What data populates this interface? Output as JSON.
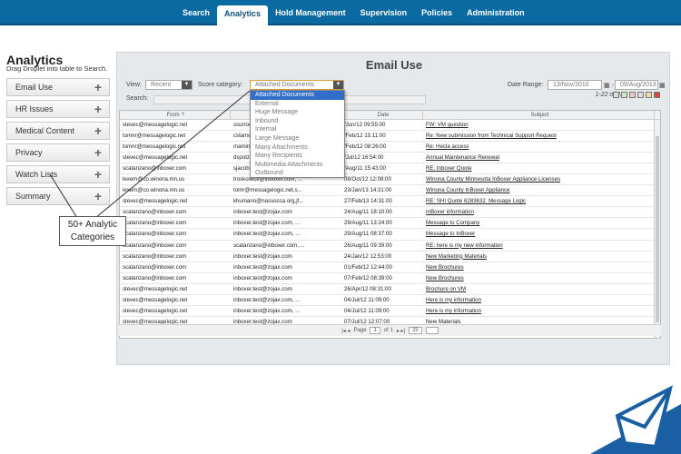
{
  "topnav": {
    "tabs": [
      {
        "label": "Search",
        "active": false
      },
      {
        "label": "Analytics",
        "active": true
      },
      {
        "label": "Hold Management",
        "active": false
      },
      {
        "label": "Supervision",
        "active": false
      },
      {
        "label": "Policies",
        "active": false
      },
      {
        "label": "Administration",
        "active": false
      }
    ]
  },
  "sidebar": {
    "title": "Analytics",
    "subtitle": "Drag Droplet into table to Search.",
    "items": [
      {
        "label": "Email Use"
      },
      {
        "label": "HR Issues"
      },
      {
        "label": "Medical Content"
      },
      {
        "label": "Privacy"
      },
      {
        "label": "Watch Lists"
      },
      {
        "label": "Summary"
      }
    ],
    "plus": "+"
  },
  "callout": {
    "line1": "50+ Analytic",
    "line2": "Categories"
  },
  "main": {
    "title": "Email Use",
    "view_label": "View:",
    "view_value": "Recent",
    "score_label": "Score category:",
    "score_value": "Attached Documents",
    "search_label": "Search:",
    "date_range_label": "Date Range:",
    "date_from": "13/Nov/2010",
    "date_to": "09/Aug/2013",
    "count": "1-22 of 22"
  },
  "dropdown": {
    "options": [
      "Attached Documents",
      "External",
      "Huge Message",
      "Inbound",
      "Internal",
      "Large Message",
      "Many Attachments",
      "Many Recipients",
      "Multimedia Attachments",
      "Outbound"
    ],
    "selected": "Attached Documents"
  },
  "table": {
    "headers": [
      "From ⇡",
      "",
      "Date",
      "Subject"
    ],
    "rows": [
      [
        "stevec@messagelogic.net",
        "ssurroc...",
        "/Jun/12 09:55:00",
        "FW: VM question"
      ],
      [
        "tomnr@messagelogic.net",
        "cstame...",
        "/Feb/12 15:11:00",
        "Re: New submission from Technical Support Request"
      ],
      [
        "tomnr@messagelogic.net",
        "mamin...",
        "/Feb/12 08:26:00",
        "Re: Hecla access"
      ],
      [
        "stevec@messagelogic.net",
        "dspotz...",
        "/Jul/12 16:54:00",
        "Annual Maintenance Renewal"
      ],
      [
        "scatanzano@inboxer.com",
        "sjacobz...",
        "/Aug/11 15:43:00",
        "RE: Inboxer Quote"
      ],
      [
        "lexem@co.winona.mn.us",
        "troskowick@inboxer.com, ...",
        "08/Oct/12 12:08:00",
        "Winona County Minnesota InBoxer Appliance Licenses"
      ],
      [
        "lexem@co.winona.mn.us",
        "tomr@messagelogic.net,s...",
        "23/Jan/13 14:31:00",
        "Winona County InBoxer Appliance"
      ],
      [
        "stevec@messagelogic.net",
        "khumann@nassocca.org,jf...",
        "27/Feb/13 14:31:00",
        "RE: SHI Quote 6283632. Message Logic"
      ],
      [
        "scatanzano@inboxer.com",
        "inboxer.test@zojax.com",
        "24/Aug/11 18:10:00",
        "InBoxer information"
      ],
      [
        "scatanzano@inboxer.com",
        "inboxer.test@zojax.com, ...",
        "29/Aug/11 13:24:00",
        "Message to Company"
      ],
      [
        "scatanzano@inboxer.com",
        "inboxer.test@zojax.com, ...",
        "29/Aug/11 08:37:00",
        "Message to InBoxer"
      ],
      [
        "scatanzano@inboxer.com",
        "scatanzano@inboxer.com, ...",
        "26/Aug/11 09:39:00",
        "RE: here is my new information"
      ],
      [
        "scatanzano@inboxer.com",
        "inboxer.test@zojax.com",
        "24/Jan/12 12:53:00",
        "New Marketing Materials"
      ],
      [
        "scatanzano@inboxer.com",
        "inboxer.test@zojax.com",
        "01/Feb/12 12:44:00",
        "New Brochures"
      ],
      [
        "scatanzano@inboxer.com",
        "inboxer.test@zojax.com",
        "07/Feb/12 08:39:00",
        "New Brochures"
      ],
      [
        "stevec@messagelogic.net",
        "inboxer.test@zojax.com",
        "26/Apr/12 08:31:00",
        "Brochure on VM"
      ],
      [
        "stevec@messagelogic.net",
        "inboxer.test@zojax.com, ...",
        "04/Jul/12 11:09:00",
        "Here is my information"
      ],
      [
        "stevec@messagelogic.net",
        "inboxer.test@zojax.com, ...",
        "04/Jul/12 11:09:00",
        "Here is my information"
      ],
      [
        "stevec@messagelogic.net",
        "inboxer.test@zojax.com",
        "07/Jul/12 12:07:00",
        "New Materials"
      ]
    ]
  },
  "pager": {
    "page_label": "Page",
    "page_value": "1",
    "of_label": "of 1",
    "per_page": "25"
  }
}
